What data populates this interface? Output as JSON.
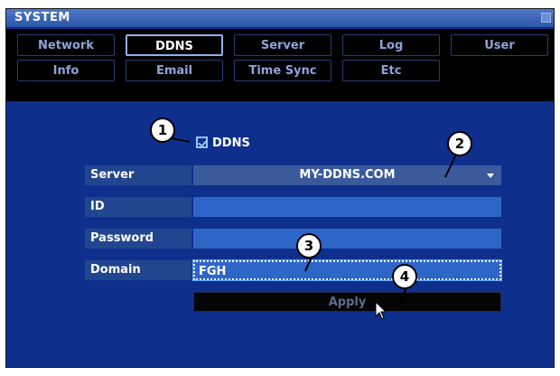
{
  "window": {
    "title": "SYSTEM"
  },
  "tabs": [
    {
      "label": "Network",
      "active": false
    },
    {
      "label": "DDNS",
      "active": true
    },
    {
      "label": "Server",
      "active": false
    },
    {
      "label": "Log",
      "active": false
    },
    {
      "label": "User",
      "active": false
    },
    {
      "label": "Info",
      "active": false
    },
    {
      "label": "Email",
      "active": false
    },
    {
      "label": "Time Sync",
      "active": false
    },
    {
      "label": "Etc",
      "active": false
    }
  ],
  "ddns": {
    "checkbox_label": "DDNS",
    "checked": true
  },
  "form": {
    "server_label": "Server",
    "server_value": "MY-DDNS.COM",
    "id_label": "ID",
    "id_value": "",
    "password_label": "Password",
    "password_value": "",
    "domain_label": "Domain",
    "domain_value": "FGH"
  },
  "apply_label": "Apply",
  "callouts": [
    "1",
    "2",
    "3",
    "4"
  ],
  "colors": {
    "window_bg": "#0f2f8d",
    "titlebar": "#2c55a8",
    "field": "#2e66c8",
    "label": "#22458f"
  }
}
